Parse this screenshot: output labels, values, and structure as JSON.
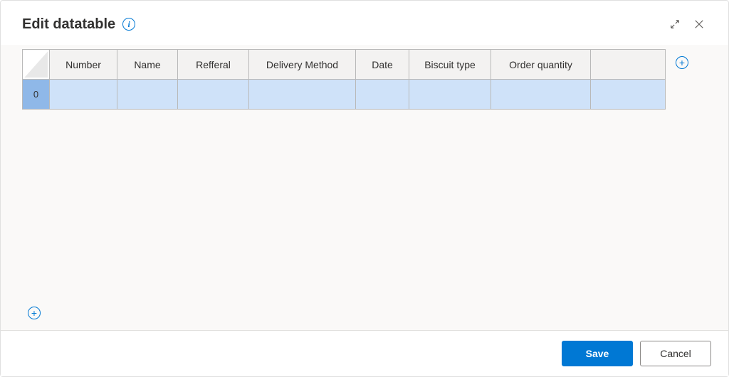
{
  "header": {
    "title": "Edit datatable"
  },
  "table": {
    "columns": [
      {
        "label": "Number"
      },
      {
        "label": "Name"
      },
      {
        "label": "Refferal"
      },
      {
        "label": "Delivery Method"
      },
      {
        "label": "Date"
      },
      {
        "label": "Biscuit type"
      },
      {
        "label": "Order quantity"
      },
      {
        "label": ""
      }
    ],
    "rows": [
      {
        "index": "0",
        "cells": [
          "",
          "",
          "",
          "",
          "",
          "",
          "",
          ""
        ]
      }
    ]
  },
  "footer": {
    "save_label": "Save",
    "cancel_label": "Cancel"
  }
}
